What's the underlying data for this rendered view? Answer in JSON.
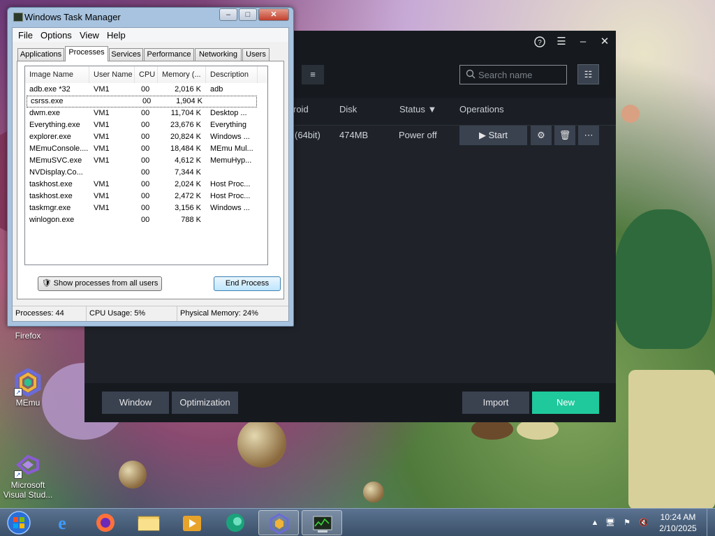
{
  "desktop": {
    "icons": [
      {
        "label": "Firefox",
        "icon": "firefox-icon"
      },
      {
        "label": "MEmu",
        "icon": "memu-icon"
      },
      {
        "label": "Microsoft Visual Stud...",
        "icon": "visual-studio-icon"
      }
    ]
  },
  "memu": {
    "top_buttons": [
      "help-icon",
      "menu-icon",
      "minimize-icon",
      "close-icon"
    ],
    "search": {
      "placeholder": "Search name"
    },
    "columns": {
      "android": "roid",
      "disk": "Disk",
      "status": "Status",
      "operations": "Operations"
    },
    "instance": {
      "android": "(64bit)",
      "disk": "474MB",
      "status": "Power off"
    },
    "ops": {
      "start": "Start",
      "settings": "settings-icon",
      "delete": "trash-icon",
      "more": "more-icon"
    },
    "footer": {
      "window": "Window",
      "optimization": "Optimization",
      "import": "Import",
      "new": "New"
    },
    "colors": {
      "bg": "#1f2329",
      "accent": "#1fc99c",
      "button": "#3a4250"
    }
  },
  "taskmgr": {
    "title": "Windows Task Manager",
    "menu": [
      "File",
      "Options",
      "View",
      "Help"
    ],
    "tabs": [
      "Applications",
      "Processes",
      "Services",
      "Performance",
      "Networking",
      "Users"
    ],
    "active_tab": "Processes",
    "headers": [
      "Image Name",
      "User Name",
      "CPU",
      "Memory (...",
      "Description"
    ],
    "rows": [
      [
        "adb.exe *32",
        "VM1",
        "00",
        "2,016 K",
        "adb"
      ],
      [
        "csrss.exe",
        "",
        "00",
        "1,904 K",
        ""
      ],
      [
        "dwm.exe",
        "VM1",
        "00",
        "11,704 K",
        "Desktop ..."
      ],
      [
        "Everything.exe",
        "VM1",
        "00",
        "23,676 K",
        "Everything"
      ],
      [
        "explorer.exe",
        "VM1",
        "00",
        "20,824 K",
        "Windows ..."
      ],
      [
        "MEmuConsole....",
        "VM1",
        "00",
        "18,484 K",
        "MEmu Mul..."
      ],
      [
        "MEmuSVC.exe",
        "VM1",
        "00",
        "4,612 K",
        "MemuHyp..."
      ],
      [
        "NVDisplay.Co...",
        "",
        "00",
        "7,344 K",
        ""
      ],
      [
        "taskhost.exe",
        "VM1",
        "00",
        "2,024 K",
        "Host Proc..."
      ],
      [
        "taskhost.exe",
        "VM1",
        "00",
        "2,472 K",
        "Host Proc..."
      ],
      [
        "taskmgr.exe",
        "VM1",
        "00",
        "3,156 K",
        "Windows ..."
      ],
      [
        "winlogon.exe",
        "",
        "00",
        "788 K",
        ""
      ]
    ],
    "show_all_label": "Show processes from all users",
    "end_process_label": "End Process",
    "status": {
      "processes": "Processes: 44",
      "cpu": "CPU Usage: 5%",
      "memory": "Physical Memory: 24%"
    }
  },
  "taskbar": {
    "apps": [
      "internet-explorer-icon",
      "firefox-icon",
      "file-explorer-icon",
      "media-player-icon",
      "edge-icon",
      "memu-icon",
      "task-manager-icon"
    ],
    "clock": {
      "time": "10:24 AM",
      "date": "2/10/2025"
    }
  }
}
